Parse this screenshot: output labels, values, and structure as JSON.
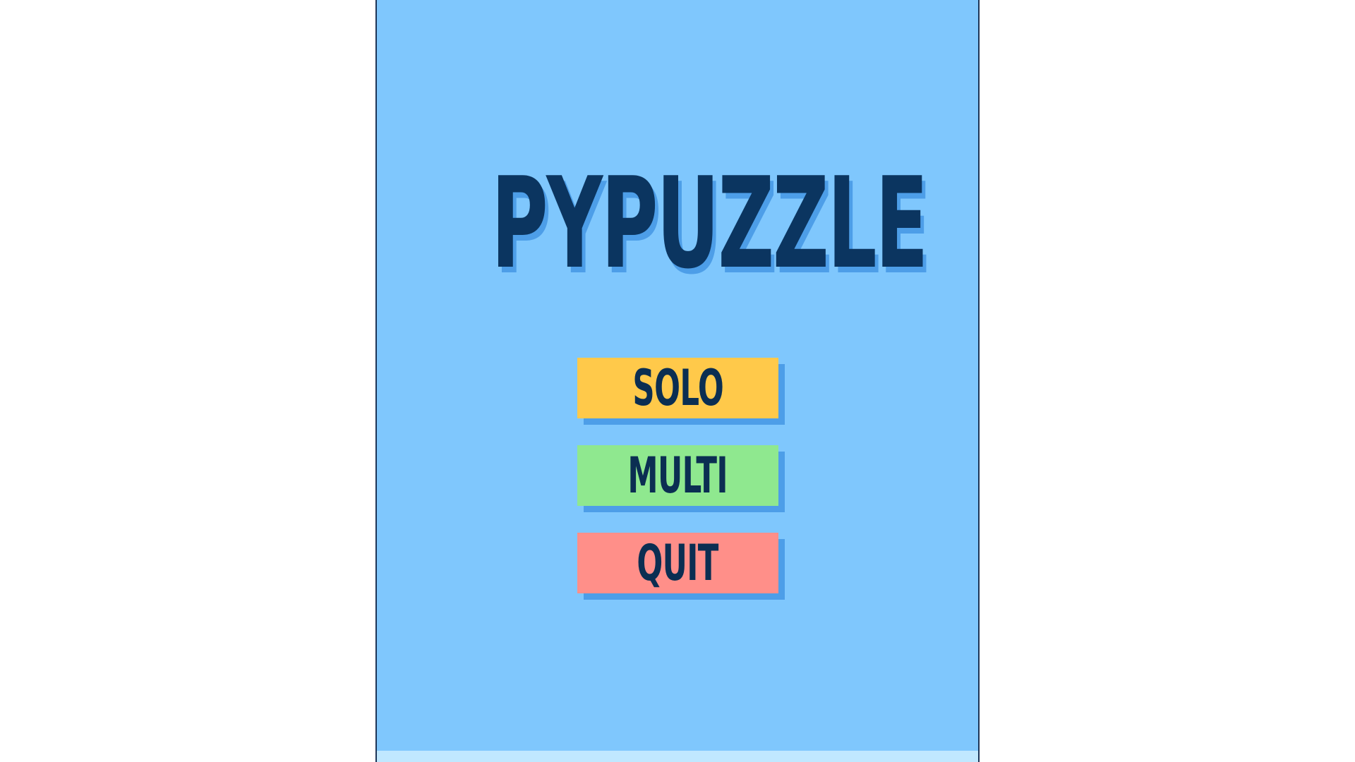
{
  "game": {
    "title": "PYPUZZLE"
  },
  "menu": {
    "buttons": [
      {
        "label": "SOLO",
        "color": "#ffc94a"
      },
      {
        "label": "MULTI",
        "color": "#8fe88f"
      },
      {
        "label": "QUIT",
        "color": "#ff8f89"
      }
    ]
  },
  "colors": {
    "background": "#7fc7fd",
    "title_text": "#0b3560",
    "shadow": "#4d9ee8",
    "bottom_strip": "#c0e8ff"
  }
}
